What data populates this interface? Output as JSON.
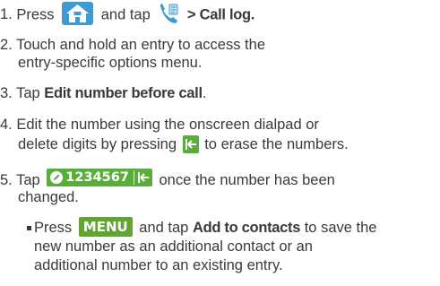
{
  "steps": [
    {
      "num": "1.",
      "pre": "Press",
      "mid": "and tap",
      "bold": "> Call log."
    },
    {
      "num": "2.",
      "line1": "Touch and hold an entry to access the",
      "line2": "entry-specific options menu."
    },
    {
      "num": "3.",
      "pre": "Tap",
      "bold": "Edit number before call",
      "post": "."
    },
    {
      "num": "4.",
      "line1": "Edit the number using the onscreen dialpad or",
      "line2_pre": "delete digits by pressing",
      "line2_post": "to erase the numbers."
    },
    {
      "num": "5.",
      "pre": "Tap",
      "field_number": "1234567",
      "post": "once the number has been",
      "line2": "changed."
    }
  ],
  "sub_step": {
    "pre": "Press",
    "key": "MENU",
    "mid": "and tap",
    "bold": "Add to contacts",
    "post": "to save the",
    "line2": "new number as an additional contact or an",
    "line3": "additional number to an existing entry."
  },
  "icons": {
    "home": "home-icon",
    "phone": "phone-icon",
    "backspace": "backspace-icon",
    "pencil": "pencil-icon"
  },
  "colors": {
    "home_bg": "#3f9ad2",
    "green": "#5aac3b",
    "menu_key": "#62a434",
    "text": "#3a3a3a"
  }
}
